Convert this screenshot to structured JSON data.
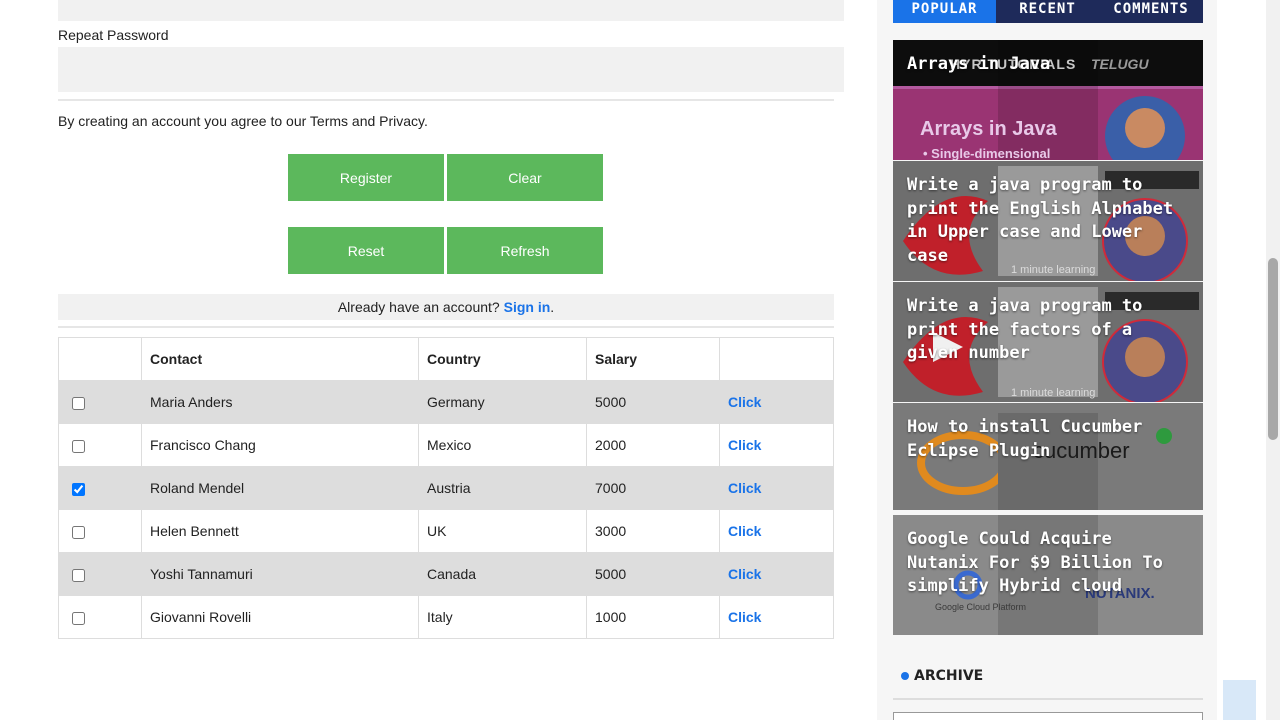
{
  "form": {
    "repeat_password_label": "Repeat Password",
    "terms_text": "By creating an account you agree to our Terms and Privacy.",
    "buttons": {
      "register": "Register",
      "clear": "Clear",
      "reset": "Reset",
      "refresh": "Refresh"
    },
    "signin_prompt": "Already have an account?",
    "signin_link": "Sign in",
    "signin_period": "."
  },
  "table": {
    "headers": [
      "",
      "Contact",
      "Country",
      "Salary",
      ""
    ],
    "rows": [
      {
        "checked": false,
        "contact": "Maria Anders",
        "country": "Germany",
        "salary": "5000",
        "action": "Click"
      },
      {
        "checked": false,
        "contact": "Francisco Chang",
        "country": "Mexico",
        "salary": "2000",
        "action": "Click"
      },
      {
        "checked": true,
        "contact": "Roland Mendel",
        "country": "Austria",
        "salary": "7000",
        "action": "Click"
      },
      {
        "checked": false,
        "contact": "Helen Bennett",
        "country": "UK",
        "salary": "3000",
        "action": "Click"
      },
      {
        "checked": false,
        "contact": "Yoshi Tannamuri",
        "country": "Canada",
        "salary": "5000",
        "action": "Click"
      },
      {
        "checked": false,
        "contact": "Giovanni Rovelli",
        "country": "Italy",
        "salary": "1000",
        "action": "Click"
      }
    ]
  },
  "sidebar": {
    "tabs": [
      "POPULAR",
      "RECENT",
      "COMMENTS"
    ],
    "posts": [
      {
        "title": "Arrays in Java",
        "thumb_text": "Arrays in Java",
        "thumb_sub": "• Single-dimensional",
        "banner_text": "HYR TUTORIALS",
        "banner_sub": "TELUGU"
      },
      {
        "title": "Write a java program to print the English Alphabet in Upper case and Lower case",
        "thumb_footer": "1 minute learning"
      },
      {
        "title": "Write a java program to print the factors of a given number",
        "thumb_footer": "1 minute learning"
      },
      {
        "title": "How to install Cucumber Eclipse Plugin",
        "thumb_text": "cucumber"
      },
      {
        "title": "Google Could Acquire Nutanix For $9 Billion To simplify Hybrid cloud",
        "thumb_left": "Google Cloud Platform",
        "thumb_right": "NUTANIX."
      }
    ],
    "archive_heading": "ARCHIVE"
  },
  "colors": {
    "button_green": "#5cb85c",
    "link_blue": "#1a73e8",
    "tab_active": "#1a73e8",
    "tab_bar": "#1e2a5a"
  }
}
